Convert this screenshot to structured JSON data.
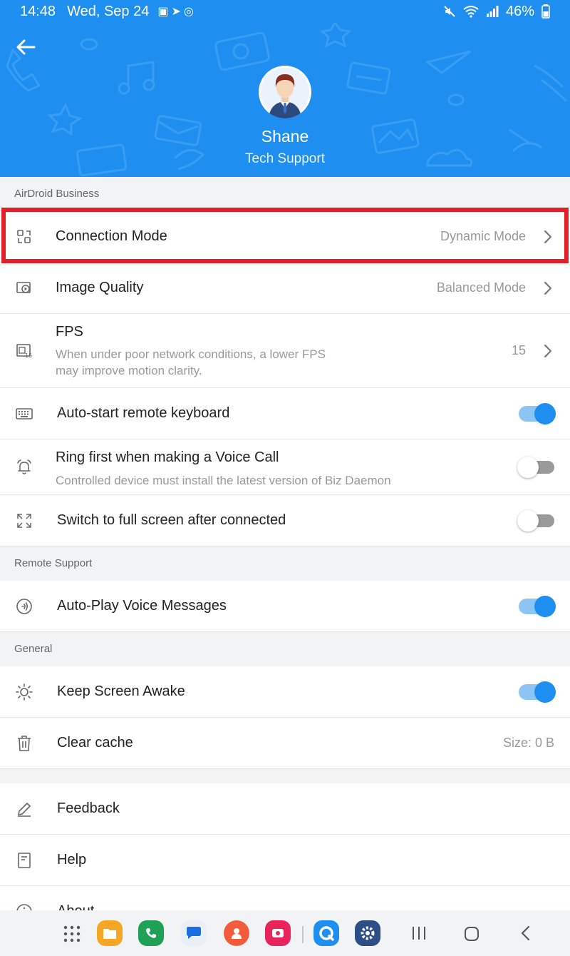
{
  "status_bar": {
    "time": "14:48",
    "date": "Wed, Sep 24",
    "battery": "46%",
    "icons": [
      "gallery-icon",
      "telegram-icon",
      "lifebuoy-icon",
      "mute-icon",
      "wifi-icon",
      "signal-icon",
      "battery-icon"
    ]
  },
  "profile": {
    "name": "Shane",
    "role": "Tech Support"
  },
  "sections": {
    "airdroid_business": "AirDroid Business",
    "remote_support": "Remote Support",
    "general": "General"
  },
  "settings": {
    "connection_mode": {
      "label": "Connection Mode",
      "value": "Dynamic Mode"
    },
    "image_quality": {
      "label": "Image Quality",
      "value": "Balanced Mode"
    },
    "fps": {
      "label": "FPS",
      "description_line1": "When under poor network conditions, a lower FPS",
      "description_line2": "may improve motion clarity.",
      "value": "15"
    },
    "auto_start_keyboard": {
      "label": "Auto-start remote keyboard",
      "enabled": true
    },
    "ring_first": {
      "label": "Ring first when making a Voice Call",
      "description": "Controlled device must install the latest version of Biz Daemon",
      "enabled": false
    },
    "full_screen": {
      "label": "Switch to full screen after connected",
      "enabled": false
    },
    "auto_play_voice": {
      "label": "Auto-Play Voice Messages",
      "enabled": true
    },
    "keep_awake": {
      "label": "Keep Screen Awake",
      "enabled": true
    },
    "clear_cache": {
      "label": "Clear cache",
      "value": "Size: 0 B"
    },
    "feedback": {
      "label": "Feedback"
    },
    "help": {
      "label": "Help"
    },
    "about": {
      "label": "About"
    }
  },
  "colors": {
    "brand_blue": "#1e8ff0",
    "highlight_red": "#e3202a"
  },
  "nav_apps": [
    "app-drawer-icon",
    "my-files-icon",
    "phone-icon",
    "messages-icon",
    "contacts-icon",
    "screen-recorder-icon",
    "airdroid-icon",
    "settings-icon"
  ]
}
